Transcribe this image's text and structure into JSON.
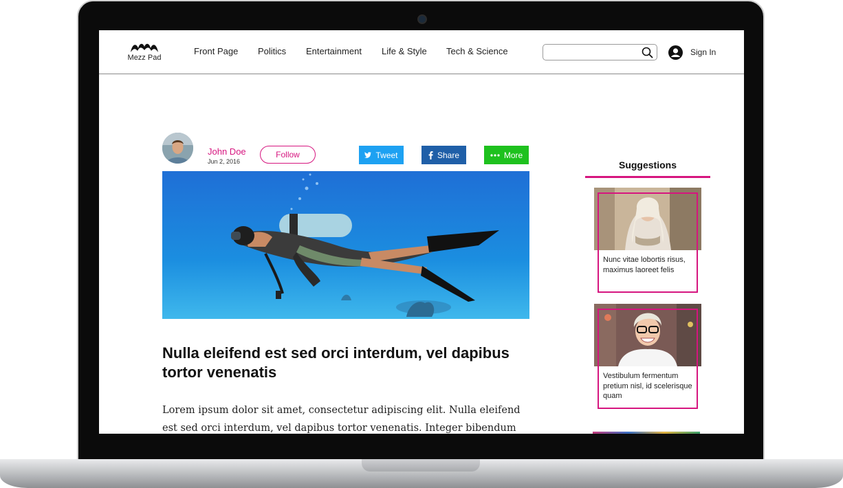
{
  "site": {
    "logo_text": "Mezz Pad",
    "nav": [
      "Front Page",
      "Politics",
      "Entertainment",
      "Life & Style",
      "Tech & Science"
    ],
    "search_placeholder": "",
    "sign_in": "Sign In"
  },
  "article": {
    "author": "John Doe",
    "date": "Jun 2, 2016",
    "follow": "Follow",
    "share_buttons": {
      "tweet": "Tweet",
      "share": "Share",
      "more": "More"
    },
    "headline": "Nulla eleifend est sed orci interdum, vel dapibus tortor venenatis",
    "body": "Lorem ipsum dolor sit amet, consectetur adipiscing elit. Nulla eleifend est sed orci interdum, vel dapibus tortor venenatis. Integer bibendum lorem sit amet maximus"
  },
  "sidebar": {
    "title": "Suggestions",
    "cards": [
      {
        "text": "Nunc vitae lobortis risus, maximus laoreet felis"
      },
      {
        "text": "Vestibulum fermentum pretium nisl, id scelerisque quam"
      }
    ]
  },
  "colors": {
    "accent": "#d6157f",
    "tweet": "#1da1f2",
    "share": "#1f5fa8",
    "more": "#1ec11e"
  },
  "icons": [
    "mustache-logo-icon",
    "search-icon",
    "user-icon",
    "twitter-icon",
    "facebook-icon",
    "more-dots-icon",
    "webcam-icon"
  ]
}
